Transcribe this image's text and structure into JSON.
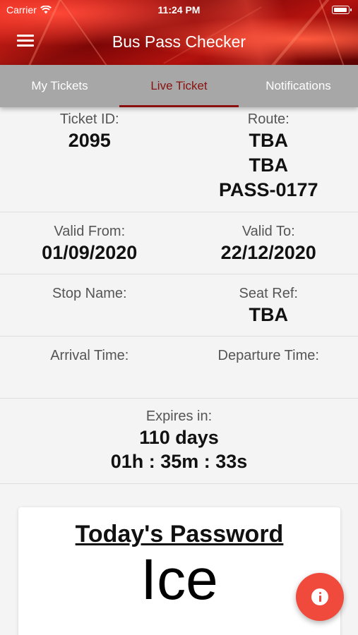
{
  "status_bar": {
    "carrier": "Carrier",
    "time": "11:24 PM",
    "wifi_icon": "wifi-icon",
    "battery_icon": "battery-icon"
  },
  "header": {
    "title": "Bus Pass Checker",
    "menu_icon": "hamburger-menu-icon"
  },
  "tabs": [
    {
      "label": "My Tickets",
      "active": false
    },
    {
      "label": "Live Ticket",
      "active": true
    },
    {
      "label": "Notifications",
      "active": false
    }
  ],
  "ticket": {
    "ticket_id_label": "Ticket ID:",
    "ticket_id": "2095",
    "route_label": "Route:",
    "route_lines": [
      "TBA",
      "TBA",
      "PASS-0177"
    ],
    "valid_from_label": "Valid From:",
    "valid_from": "01/09/2020",
    "valid_to_label": "Valid To:",
    "valid_to": "22/12/2020",
    "stop_name_label": "Stop Name:",
    "stop_name": "",
    "seat_ref_label": "Seat Ref:",
    "seat_ref": "TBA",
    "arrival_time_label": "Arrival Time:",
    "arrival_time": "",
    "departure_time_label": "Departure Time:",
    "departure_time": "",
    "expires_label": "Expires in:",
    "expires_days": "110 days",
    "expires_countdown": "01h : 35m : 33s"
  },
  "password_card": {
    "title": "Today's Password",
    "password": "Ice"
  },
  "fab": {
    "icon": "info-icon"
  },
  "colors": {
    "accent": "#8a1010",
    "fab": "#f04a3c",
    "tab_bar": "#a7a7a7"
  }
}
